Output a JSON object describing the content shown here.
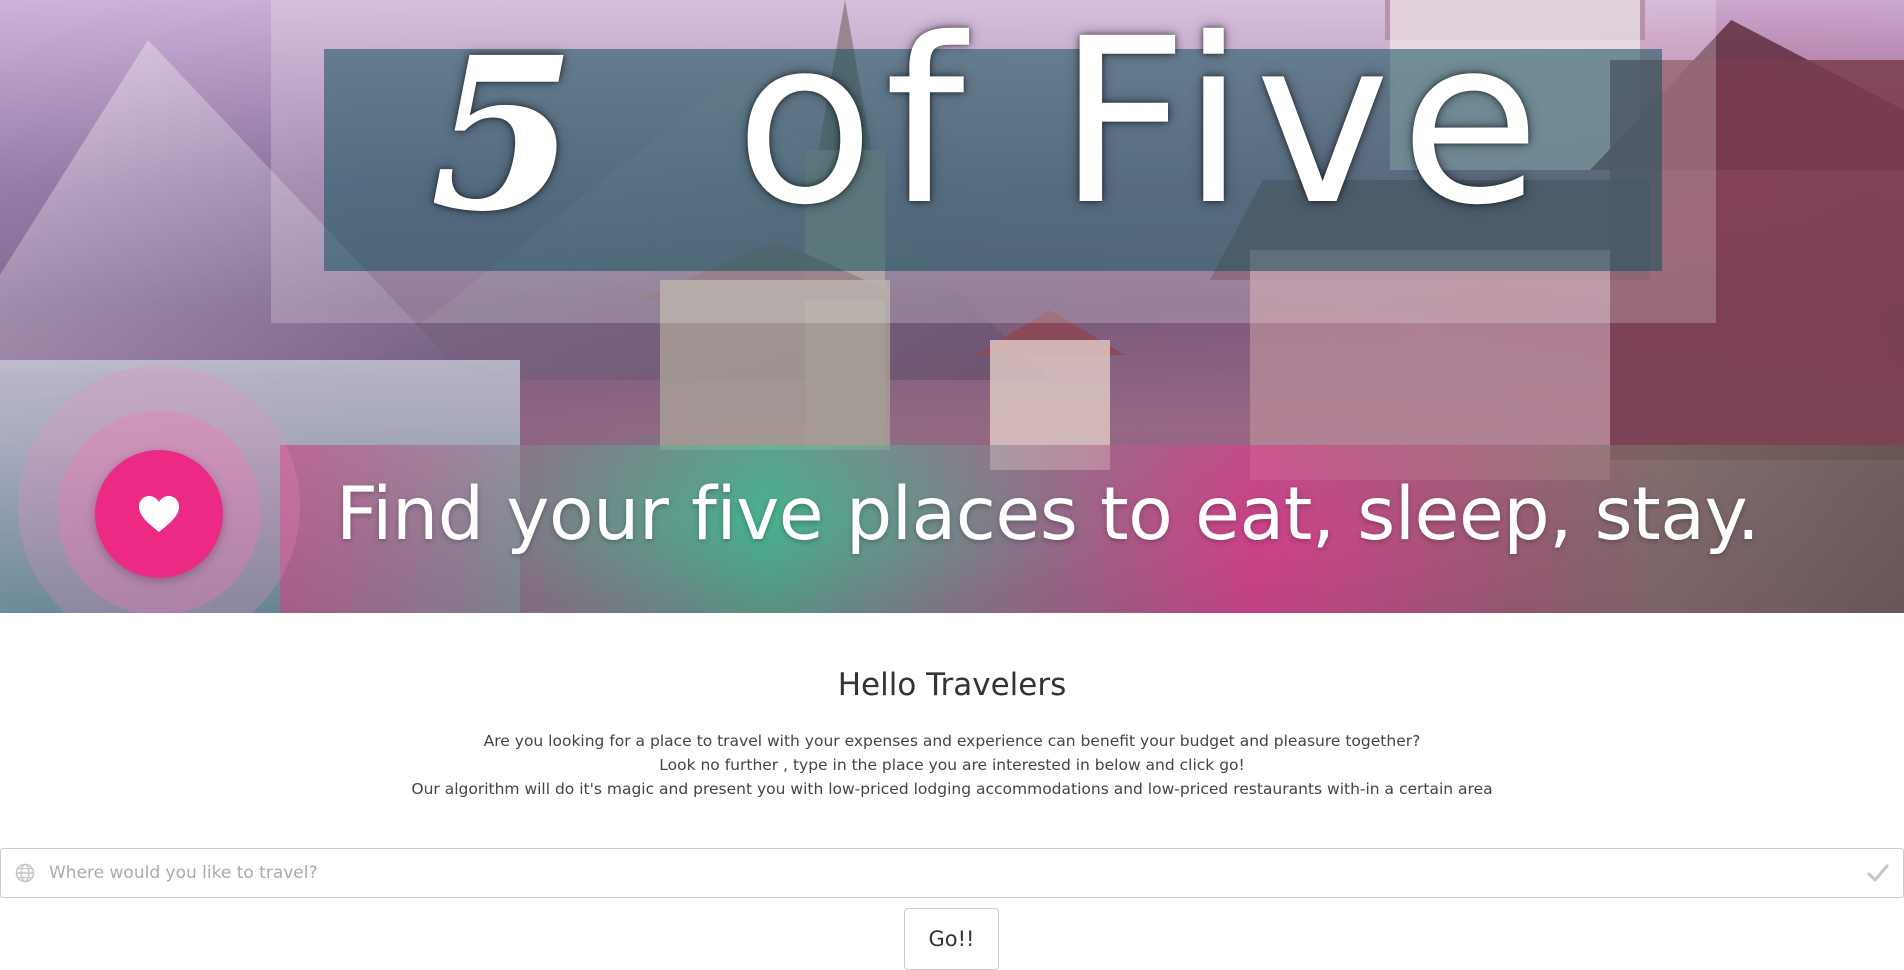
{
  "hero": {
    "title_number": "5",
    "title_rest": "of Five",
    "tagline": "Find your five places to eat, sleep, stay.",
    "favorite_icon": "heart-icon",
    "accent_color": "#ec2a86"
  },
  "main": {
    "heading": "Hello Travelers",
    "intro_lines": [
      "Are you looking for a place to travel with your expenses and experience can benefit your budget and pleasure together?",
      "Look no further , type in the place you are interested in below and click go!",
      "Our algorithm will do it's magic and present you with low-priced lodging accommodations and low-priced restaurants with-in a certain area"
    ]
  },
  "search": {
    "placeholder": "Where would you like to travel?",
    "value": "",
    "left_icon": "globe-icon",
    "right_icon": "check-icon"
  },
  "go_button": {
    "label": "Go!!"
  }
}
